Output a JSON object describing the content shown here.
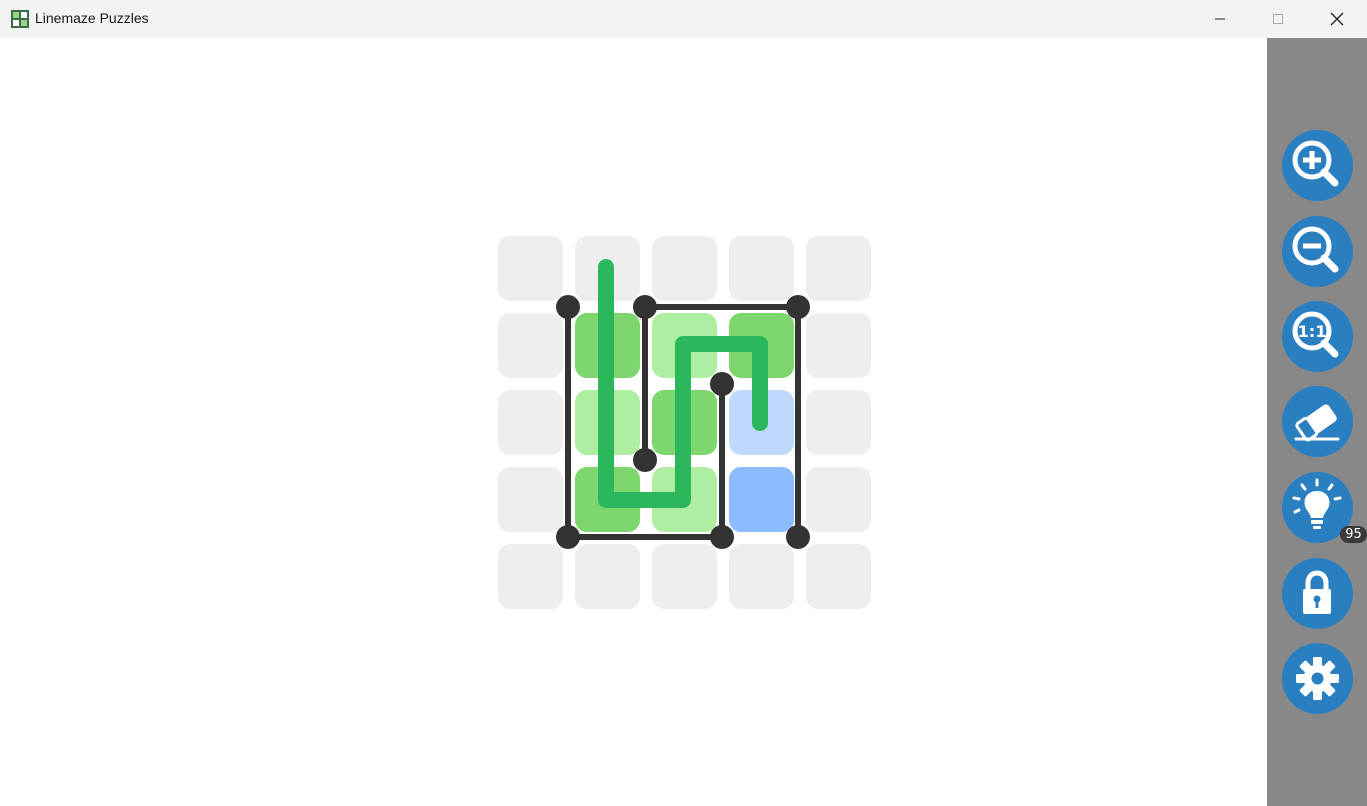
{
  "window": {
    "title": "Linemaze Puzzles",
    "minimize_icon": "minimize-icon",
    "maximize_icon": "maximize-icon",
    "close_icon": "close-icon"
  },
  "toolbar": {
    "buttons": [
      {
        "id": "zoom-in",
        "icon": "zoom-in-icon"
      },
      {
        "id": "zoom-out",
        "icon": "zoom-out-icon"
      },
      {
        "id": "zoom-reset",
        "icon": "zoom-reset-icon",
        "label": "1:1"
      },
      {
        "id": "eraser",
        "icon": "eraser-icon"
      },
      {
        "id": "hint",
        "icon": "lightbulb-icon",
        "badge": "95"
      },
      {
        "id": "lock",
        "icon": "lock-icon"
      },
      {
        "id": "settings",
        "icon": "gear-icon"
      }
    ]
  },
  "puzzle": {
    "rows": 5,
    "cols": 5,
    "cells": [
      [
        "empty",
        "empty",
        "empty",
        "empty",
        "empty"
      ],
      [
        "empty",
        "green-dark",
        "green-light",
        "green-dark",
        "empty"
      ],
      [
        "empty",
        "green-light",
        "green-dark",
        "blue-light",
        "empty"
      ],
      [
        "empty",
        "green-dark",
        "green-light",
        "blue-dark",
        "empty"
      ],
      [
        "empty",
        "empty",
        "empty",
        "empty",
        "empty"
      ]
    ]
  },
  "colors": {
    "empty": "#eeeeee",
    "green-dark": "#7ed66f",
    "green-light": "#adeea0",
    "blue-light": "#c0daff",
    "blue-dark": "#8bbcff",
    "path": "#2cb75c",
    "wall": "#333333",
    "accent": "#2a7fc1",
    "sidebar": "#888888"
  }
}
